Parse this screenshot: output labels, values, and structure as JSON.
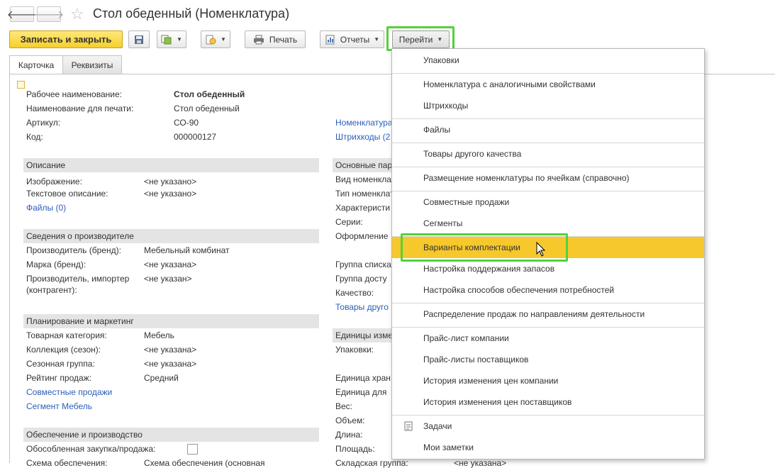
{
  "window": {
    "title": "Стол обеденный (Номенклатура)"
  },
  "nav": {
    "back_icon": "arrow-left-icon",
    "forward_icon": "arrow-right-icon",
    "favorite_icon": "star-icon"
  },
  "toolbar": {
    "save_close": "Записать и закрыть",
    "print": "Печать",
    "reports": "Отчеты",
    "goto": "Перейти"
  },
  "tabs": [
    {
      "label": "Карточка"
    },
    {
      "label": "Реквизиты"
    }
  ],
  "header_fields": {
    "work_name_label": "Рабочее наименование:",
    "work_name_value": "Стол обеденный",
    "print_name_label": "Наименование для печати:",
    "print_name_value": "Стол обеденный",
    "article_label": "Артикул:",
    "article_value": "СО-90",
    "code_label": "Код:",
    "code_value": "000000127"
  },
  "right_links": {
    "similar": "Номенклатура",
    "barcodes": "Штрихкоды (2"
  },
  "description": {
    "header": "Описание",
    "image_label": "Изображение:",
    "image_value": "<не указано>",
    "text_label": "Текстовое описание:",
    "text_value": "<не указано>",
    "files_link": "Файлы (0)"
  },
  "manufacturer": {
    "header": "Сведения о производителе",
    "brand_label": "Производитель (бренд):",
    "brand_value": "Мебельный комбинат",
    "mark_label": "Марка (бренд):",
    "mark_value": "<не указана>",
    "importer_label_1": "Производитель, импортер",
    "importer_label_2": "(контрагент):",
    "importer_value": "<не указан>"
  },
  "planning": {
    "header": "Планирование и маркетинг",
    "category_label": "Товарная категория:",
    "category_value": "Мебель",
    "collection_label": "Коллекция (сезон):",
    "collection_value": "<не указана>",
    "season_label": "Сезонная группа:",
    "season_value": "<не указана>",
    "rating_label": "Рейтинг продаж:",
    "rating_value": "Средний",
    "joint_link": "Совместные продажи",
    "segment_link": "Сегмент Мебель"
  },
  "supply": {
    "header": "Обеспечение и производство",
    "separate_label": "Обособленная закупка/продажа:",
    "scheme_label": "Схема обеспечения:",
    "scheme_value": "Схема обеспечения (основная"
  },
  "right_column": {
    "main_params_header": "Основные пар",
    "kind_label": "Вид номенклат",
    "type_label": "Тип номенклат",
    "characteristics_label": "Характеристи",
    "series_label": "Серии:",
    "design_label": "Оформление",
    "list_group_label": "Группа списка",
    "access_group_label": "Группа досту",
    "quality_label": "Качество:",
    "other_quality_link": "Товары друго",
    "units_header": "Единицы изме",
    "packages_label": "Упаковки:",
    "storage_unit_label": "Единица хран",
    "unit_for_label": "Единица для",
    "weight_label": "Вес:",
    "volume_label": "Объем:",
    "length_label": "Длина:",
    "area_label": "Площадь:",
    "warehouse_group_label": "Складская группа:",
    "warehouse_group_value": "<не указана>"
  },
  "menu": {
    "items": [
      {
        "label": "Упаковки"
      },
      {
        "label": "Номенклатура с аналогичными свойствами"
      },
      {
        "label": "Штрихкоды"
      },
      {
        "label": "Файлы"
      },
      {
        "label": "Товары другого качества"
      },
      {
        "label": "Размещение номенклатуры по ячейкам (справочно)"
      },
      {
        "label": "Совместные продажи"
      },
      {
        "label": "Сегменты"
      },
      {
        "label": "Варианты комплектации"
      },
      {
        "label": "Настройка поддержания запасов"
      },
      {
        "label": "Настройка способов обеспечения потребностей"
      },
      {
        "label": "Распределение продаж по направлениям деятельности"
      },
      {
        "label": "Прайс-лист компании"
      },
      {
        "label": "Прайс-листы поставщиков"
      },
      {
        "label": "История изменения цен компании"
      },
      {
        "label": "История изменения цен поставщиков"
      },
      {
        "label": "Задачи"
      },
      {
        "label": "Мои заметки"
      }
    ],
    "highlight_color": "#f7c82b",
    "focus_outline_color": "#53d13b"
  }
}
